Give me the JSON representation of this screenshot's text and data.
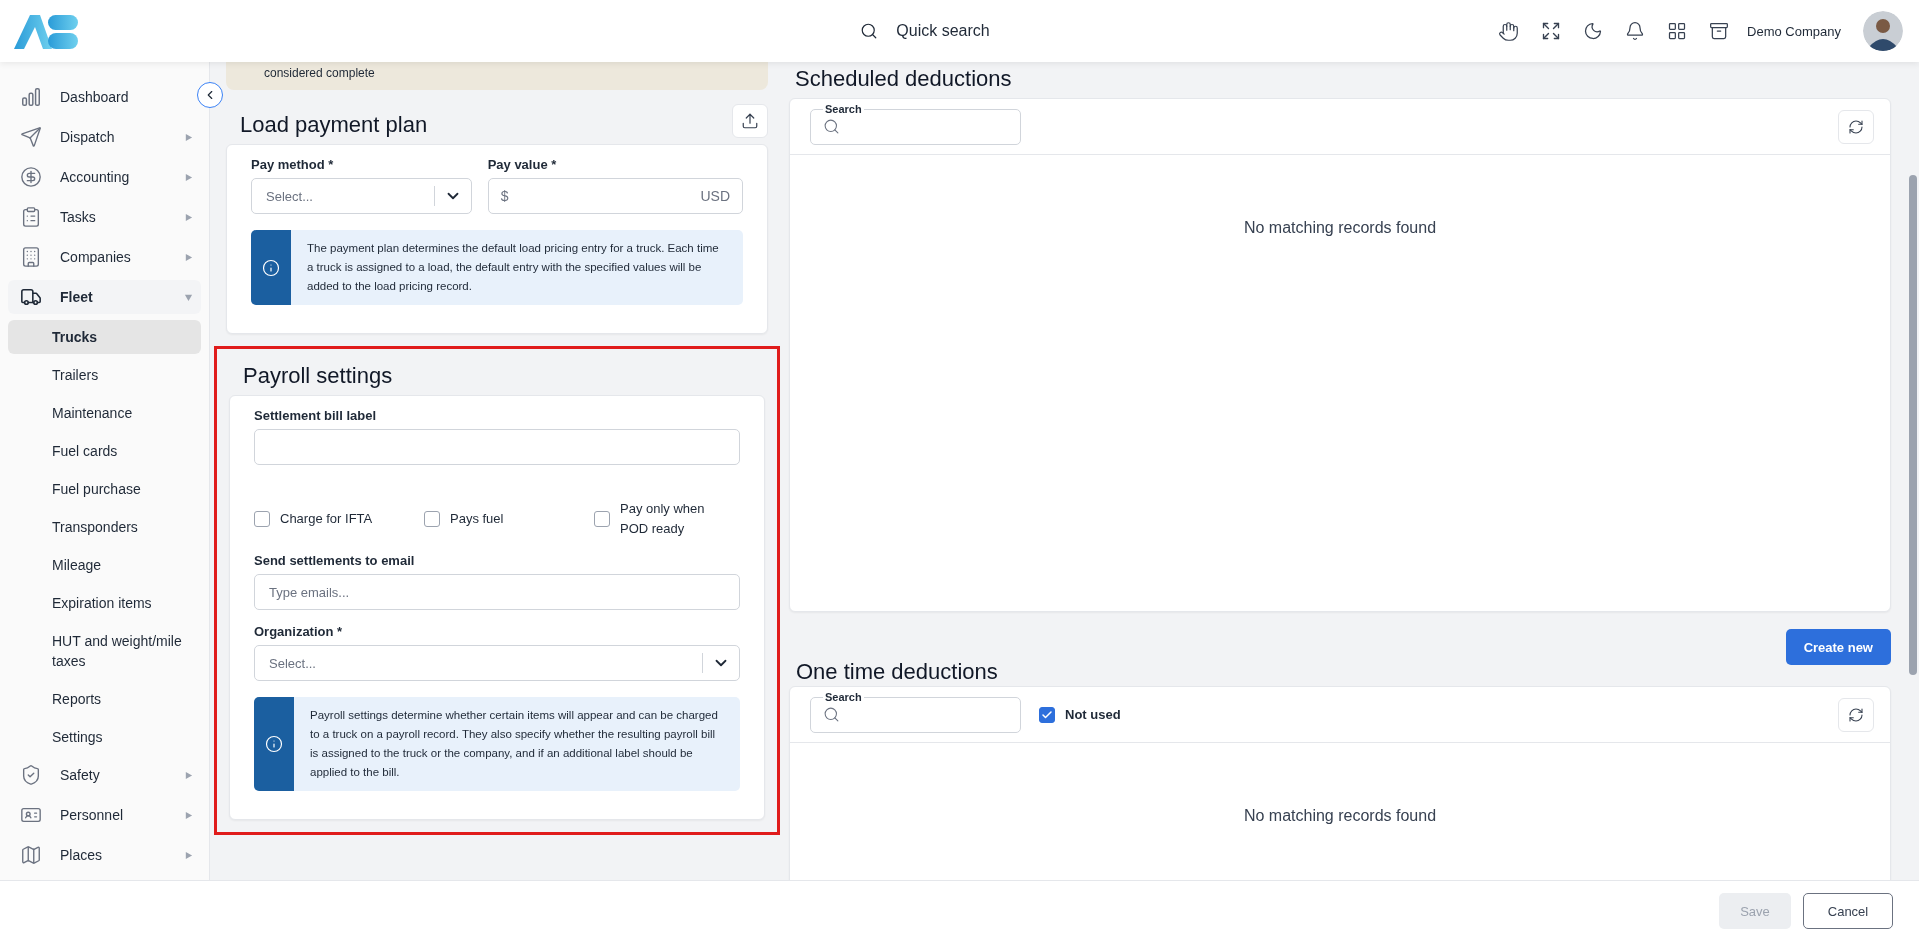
{
  "header": {
    "search_label": "Quick search",
    "company": "Demo Company"
  },
  "sidebar": {
    "items": [
      {
        "label": "Dashboard",
        "selected": false
      },
      {
        "label": "Dispatch",
        "expanded": false,
        "selected": false
      },
      {
        "label": "Accounting",
        "expanded": false,
        "selected": false
      },
      {
        "label": "Tasks",
        "expanded": false,
        "selected": false
      },
      {
        "label": "Companies",
        "expanded": false,
        "selected": false
      },
      {
        "label": "Fleet",
        "expanded": true,
        "selected": true,
        "children": [
          {
            "label": "Trucks",
            "selected": true
          },
          {
            "label": "Trailers",
            "selected": false
          },
          {
            "label": "Maintenance",
            "selected": false
          },
          {
            "label": "Fuel cards",
            "selected": false
          },
          {
            "label": "Fuel purchase",
            "selected": false
          },
          {
            "label": "Transponders",
            "selected": false
          },
          {
            "label": "Mileage",
            "selected": false
          },
          {
            "label": "Expiration items",
            "selected": false
          },
          {
            "label": "HUT and weight/mile taxes",
            "selected": false
          },
          {
            "label": "Reports",
            "selected": false
          },
          {
            "label": "Settings",
            "selected": false
          }
        ]
      },
      {
        "label": "Safety",
        "expanded": false,
        "selected": false
      },
      {
        "label": "Personnel",
        "expanded": false,
        "selected": false
      },
      {
        "label": "Places",
        "expanded": false,
        "selected": false
      }
    ]
  },
  "notice": {
    "text": "considered complete"
  },
  "load_payment_plan": {
    "title": "Load payment plan",
    "pay_method": {
      "label": "Pay method *",
      "placeholder": "Select..."
    },
    "pay_value": {
      "label": "Pay value *",
      "prefix": "$",
      "suffix": "USD"
    },
    "info": "The payment plan determines the default load pricing entry for a truck. Each time a truck is assigned to a load, the default entry with the specified values will be added to the load pricing record."
  },
  "payroll_settings": {
    "title": "Payroll settings",
    "highlighted": true,
    "bill_label": {
      "label": "Settlement bill label"
    },
    "checkboxes": [
      {
        "label": "Charge for IFTA",
        "checked": false
      },
      {
        "label": "Pays fuel",
        "checked": false
      },
      {
        "label": "Pay only when POD ready",
        "checked": false
      }
    ],
    "email": {
      "label": "Send settlements to email",
      "placeholder": "Type emails..."
    },
    "organization": {
      "label": "Organization *",
      "placeholder": "Select..."
    },
    "info": "Payroll settings determine whether certain items will appear and can be charged to a truck on a payroll record. They also specify whether the resulting payroll bill is assigned to the truck or the company, and if an additional label should be applied to the bill."
  },
  "scheduled_deductions": {
    "title": "Scheduled deductions",
    "search_label": "Search",
    "empty": "No matching records found"
  },
  "one_time_deductions": {
    "title": "One time deductions",
    "create_button": "Create new",
    "search_label": "Search",
    "not_used": {
      "label": "Not used",
      "checked": true
    },
    "empty": "No matching records found"
  },
  "footer": {
    "save": {
      "label": "Save",
      "disabled": true
    },
    "cancel": "Cancel"
  }
}
